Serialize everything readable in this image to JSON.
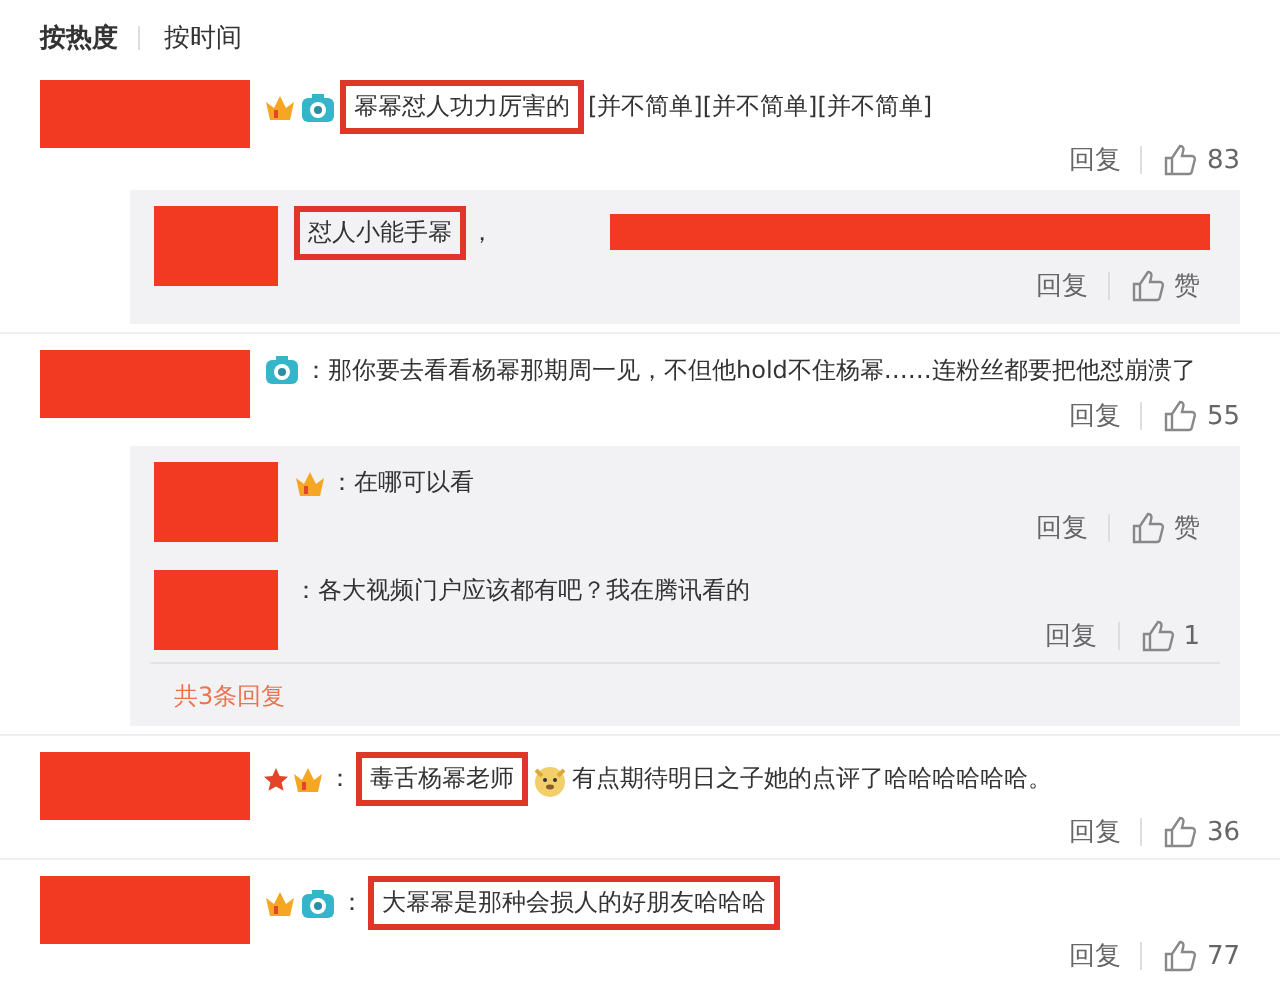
{
  "sort_tabs": [
    {
      "label": "按热度",
      "selected": true
    },
    {
      "label": "按时间",
      "selected": false
    }
  ],
  "comments": [
    {
      "badges": [
        {
          "kind": "vip"
        },
        {
          "kind": "camera"
        }
      ],
      "highlight": "幂幂怼人功力厉害的",
      "text": "[并不简单][并不简单][并不简单]",
      "reply_label": "回复",
      "likes": "83",
      "replies": [
        {
          "highlight": "怼人小能手幂",
          "text": "，",
          "reply_label": "回复",
          "likes": "赞"
        }
      ]
    },
    {
      "badges": [
        {
          "kind": "camera"
        }
      ],
      "text": "：那你要去看看杨幂那期周一见，不但他hold不住杨幂……连粉丝都要把他怼崩溃了",
      "reply_label": "回复",
      "likes": "55",
      "replies": [
        {
          "badges": [
            {
              "kind": "vip"
            }
          ],
          "text": "：在哪可以看",
          "reply_label": "回复",
          "likes": "赞"
        },
        {
          "text": "：各大视频门户应该都有吧？我在腾讯看的",
          "reply_label": "回复",
          "likes": "1"
        }
      ],
      "more_replies": "共3条回复"
    },
    {
      "badges": [
        {
          "kind": "star"
        },
        {
          "kind": "vip"
        }
      ],
      "prefix": "：",
      "highlight": "毒舌杨幂老师",
      "emoji": {
        "kind": "dog"
      },
      "text": "有点期待明日之子她的点评了哈哈哈哈哈哈。",
      "reply_label": "回复",
      "likes": "36"
    },
    {
      "badges": [
        {
          "kind": "vip"
        },
        {
          "kind": "camera"
        }
      ],
      "prefix": "：",
      "highlight": "大幂幂是那种会损人的好朋友哈哈哈",
      "reply_label": "回复",
      "likes": "77"
    }
  ]
}
